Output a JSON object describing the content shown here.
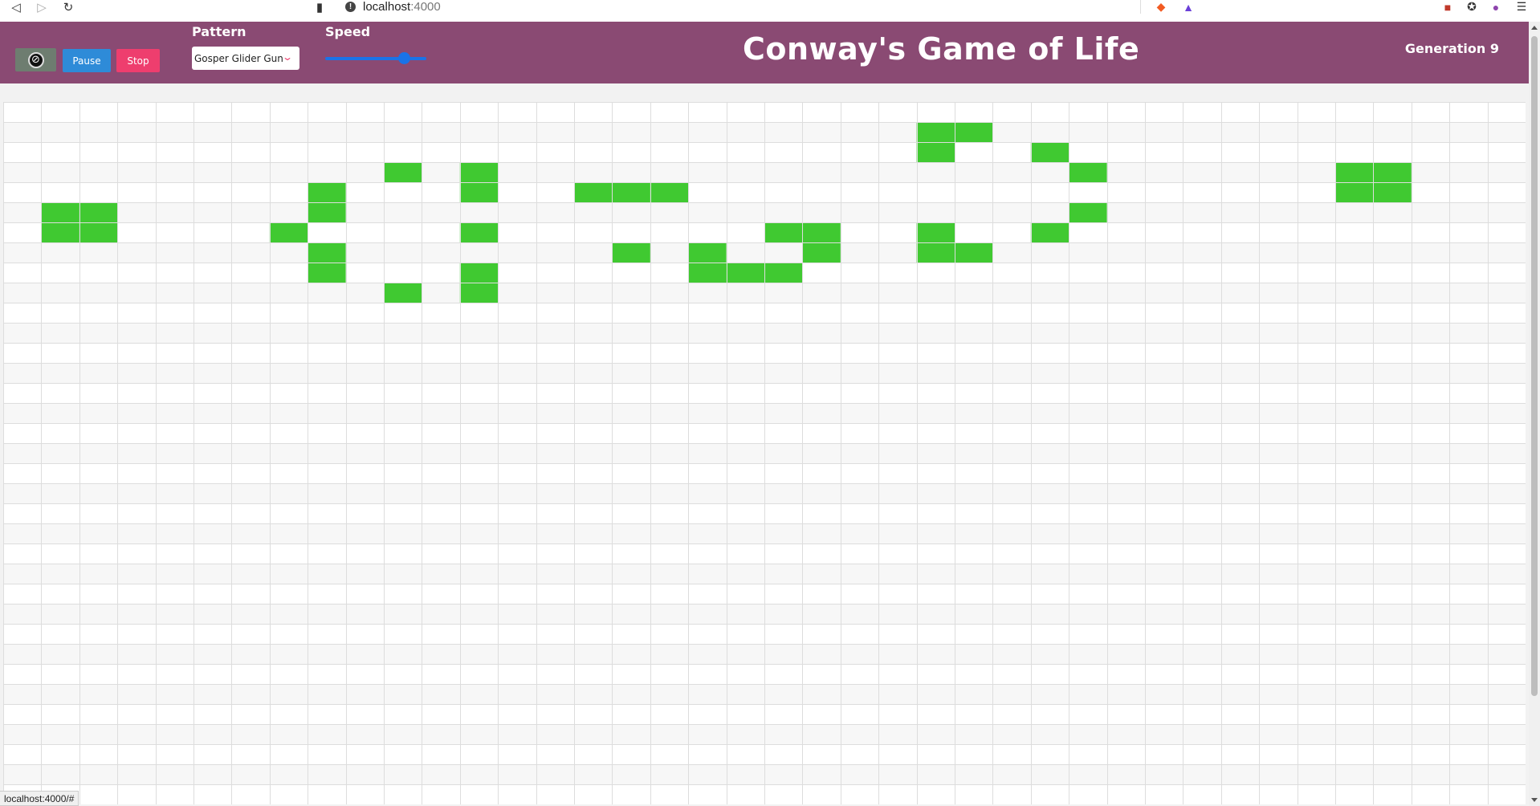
{
  "browser": {
    "url_host": "localhost",
    "url_port": ":4000",
    "status_url": "localhost:4000/#"
  },
  "toolbar": {
    "clear_icon": "no-entry-icon",
    "pause_label": "Pause",
    "stop_label": "Stop",
    "pattern_label": "Pattern",
    "pattern_selected": "Gosper Glider Gun",
    "speed_label": "Speed",
    "speed_value": 0.78
  },
  "header": {
    "title": "Conway's Game of Life",
    "generation": "Generation 9"
  },
  "colors": {
    "header_bg": "#8a4a73",
    "alive": "#40c931",
    "pause_button": "#2e8bd8",
    "stop_button": "#ee3e6e"
  },
  "board": {
    "columns": 40,
    "rows": 35,
    "alive_cells": [
      [
        24,
        1
      ],
      [
        25,
        1
      ],
      [
        24,
        2
      ],
      [
        27,
        2
      ],
      [
        10,
        3
      ],
      [
        12,
        3
      ],
      [
        28,
        3
      ],
      [
        35,
        3
      ],
      [
        36,
        3
      ],
      [
        8,
        4
      ],
      [
        12,
        4
      ],
      [
        15,
        4
      ],
      [
        16,
        4
      ],
      [
        17,
        4
      ],
      [
        35,
        4
      ],
      [
        36,
        4
      ],
      [
        1,
        5
      ],
      [
        2,
        5
      ],
      [
        8,
        5
      ],
      [
        28,
        5
      ],
      [
        1,
        6
      ],
      [
        2,
        6
      ],
      [
        7,
        6
      ],
      [
        12,
        6
      ],
      [
        20,
        6
      ],
      [
        21,
        6
      ],
      [
        24,
        6
      ],
      [
        27,
        6
      ],
      [
        8,
        7
      ],
      [
        16,
        7
      ],
      [
        18,
        7
      ],
      [
        21,
        7
      ],
      [
        24,
        7
      ],
      [
        25,
        7
      ],
      [
        8,
        8
      ],
      [
        12,
        8
      ],
      [
        18,
        8
      ],
      [
        19,
        8
      ],
      [
        20,
        8
      ],
      [
        10,
        9
      ],
      [
        12,
        9
      ]
    ]
  }
}
